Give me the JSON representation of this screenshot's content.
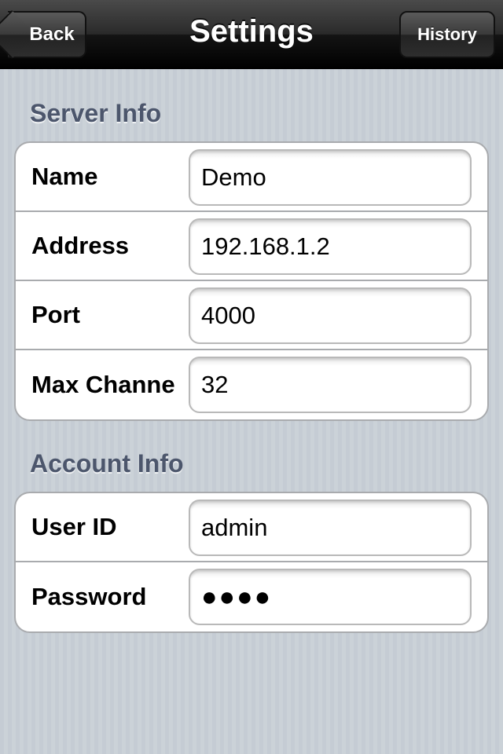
{
  "navbar": {
    "title": "Settings",
    "back_label": "Back",
    "history_label": "History"
  },
  "server_info": {
    "header": "Server Info",
    "rows": [
      {
        "label": "Name",
        "value": "Demo"
      },
      {
        "label": "Max Channe",
        "value": "32"
      },
      {
        "label": "Address",
        "value": "192.168.1.2"
      },
      {
        "label": "Port",
        "value": "4000"
      }
    ]
  },
  "account_info": {
    "header": "Account Info",
    "user_id_label": "User ID",
    "user_id_value": "admin",
    "password_label": "Password",
    "password_value": "●●●●"
  }
}
